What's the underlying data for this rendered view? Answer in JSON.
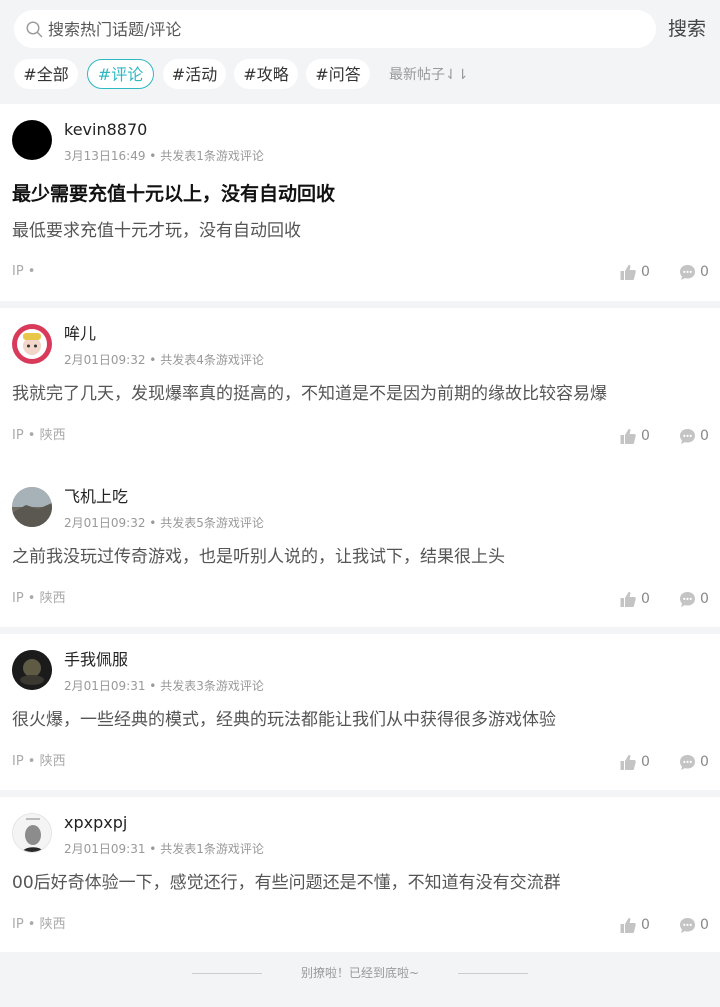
{
  "search": {
    "placeholder": "搜索热门话题/评论",
    "button_label": "搜索"
  },
  "tags": [
    "#全部",
    "#评论",
    "#活动",
    "#攻略",
    "#问答"
  ],
  "sort_label": "最新帖子⇃⇂",
  "posts": [
    {
      "username": "kevin8870",
      "meta": "3月13日16:49 • 共发表1条游戏评论",
      "title": "最少需要充值十元以上，没有自动回收",
      "content": "最低要求充值十元才玩，没有自动回收",
      "ip": "IP •",
      "likes": "0",
      "comments": "0"
    },
    {
      "username": "哞儿",
      "meta": "2月01日09:32 • 共发表4条游戏评论",
      "content": "我就完了几天，发现爆率真的挺高的，不知道是不是因为前期的缘故比较容易爆",
      "ip": "IP • 陕西",
      "likes": "0",
      "comments": "0"
    },
    {
      "username": "飞机上吃",
      "meta": "2月01日09:32 • 共发表5条游戏评论",
      "content": "之前我没玩过传奇游戏，也是听别人说的，让我试下，结果很上头",
      "ip": "IP • 陕西",
      "likes": "0",
      "comments": "0"
    },
    {
      "username": "手我佩服",
      "meta": "2月01日09:31 • 共发表3条游戏评论",
      "content": "很火爆，一些经典的模式，经典的玩法都能让我们从中获得很多游戏体验",
      "ip": "IP • 陕西",
      "likes": "0",
      "comments": "0"
    },
    {
      "username": "xpxpxpj",
      "meta": "2月01日09:31 • 共发表1条游戏评论",
      "content": "00后好奇体验一下，感觉还行，有些问题还是不懂，不知道有没有交流群",
      "ip": "IP • 陕西",
      "likes": "0",
      "comments": "0"
    }
  ],
  "footer_text": "别撩啦！已经到底啦~",
  "colors": {
    "accent": "#2eb8c2",
    "background": "#f3f4f6"
  }
}
